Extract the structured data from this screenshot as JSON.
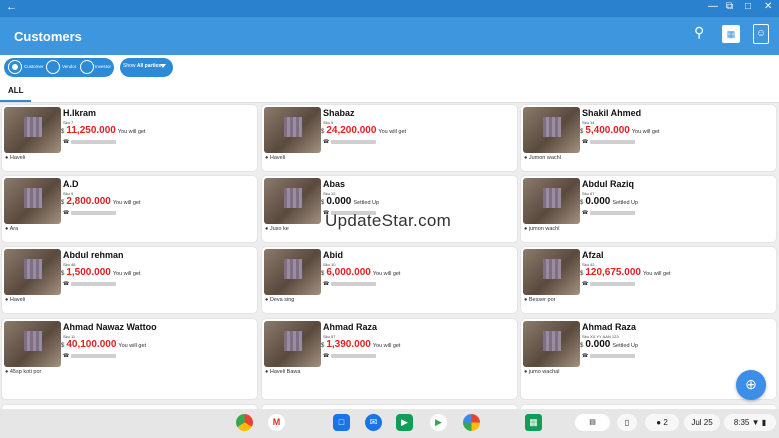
{
  "window": {
    "back_icon": "arrow-left-icon",
    "controls": [
      "minimize-icon",
      "restore-icon",
      "maximize-icon",
      "close-icon"
    ]
  },
  "appbar": {
    "title": "Customers",
    "actions": [
      "search-icon",
      "report-icon",
      "contacts-icon"
    ]
  },
  "filters": {
    "party_types": [
      {
        "label": "Customer",
        "selected": true
      },
      {
        "label": "Vendor",
        "selected": false
      },
      {
        "label": "Investor",
        "selected": false
      }
    ],
    "show_label_prefix": "Show",
    "show_label_value": "All parties"
  },
  "tabs": [
    {
      "label": "ALL"
    }
  ],
  "currency": "$",
  "customers": [
    {
      "name": "H.Ikram",
      "sku": "Sku 7",
      "amount": "11,250.000",
      "status": "You will get",
      "location": "Haveli"
    },
    {
      "name": "Shabaz",
      "sku": "Sku 5",
      "amount": "24,200.000",
      "status": "You will get",
      "location": "Haveli"
    },
    {
      "name": "Shakil Ahmed",
      "sku": "Sku 14",
      "amount": "5,400.000",
      "status": "You will get",
      "location": "Jumon wachl"
    },
    {
      "name": "A.D",
      "sku": "Sku 9",
      "amount": "2,800.000",
      "status": "You will get",
      "location": "Ara"
    },
    {
      "name": "Abas",
      "sku": "Sku 12",
      "amount": "0.000",
      "status": "Settled Up",
      "location": "Juso ke"
    },
    {
      "name": "Abdul Raziq",
      "sku": "Sku 67",
      "amount": "0.000",
      "status": "Settled Up",
      "location": "jumon wachl"
    },
    {
      "name": "Abdul rehman",
      "sku": "Sku 48",
      "amount": "1,500.000",
      "status": "You will get",
      "location": "Haveli"
    },
    {
      "name": "Abid",
      "sku": "Sku 10",
      "amount": "6,000.000",
      "status": "You will get",
      "location": "Deva sing"
    },
    {
      "name": "Afzal",
      "sku": "Sku 42",
      "amount": "120,675.000",
      "status": "You will get",
      "location": "Besser por"
    },
    {
      "name": "Ahmad Nawaz Wattoo",
      "sku": "Sku 11",
      "amount": "40,100.000",
      "status": "You will get",
      "location": "45sp koti por"
    },
    {
      "name": "Ahmad Raza",
      "sku": "Sku 57",
      "amount": "1,390.000",
      "status": "You will get",
      "location": "Haveli Bawa"
    },
    {
      "name": "Ahmad Raza",
      "sku": "Sku XX YY AAN 123",
      "amount": "0.000",
      "status": "Settled Up",
      "location": "jumo wachal"
    }
  ],
  "watermark": "UpdateStar.com",
  "fab": {
    "icon": "plus-circle-icon"
  },
  "shelf": {
    "apps": [
      "chrome-icon",
      "gmail-icon",
      "files-icon",
      "messages-icon",
      "meet-icon",
      "play-store-icon",
      "photos-icon",
      "sheets-icon"
    ],
    "notification_count": "2",
    "date": "Jul 25",
    "time": "8:35"
  }
}
